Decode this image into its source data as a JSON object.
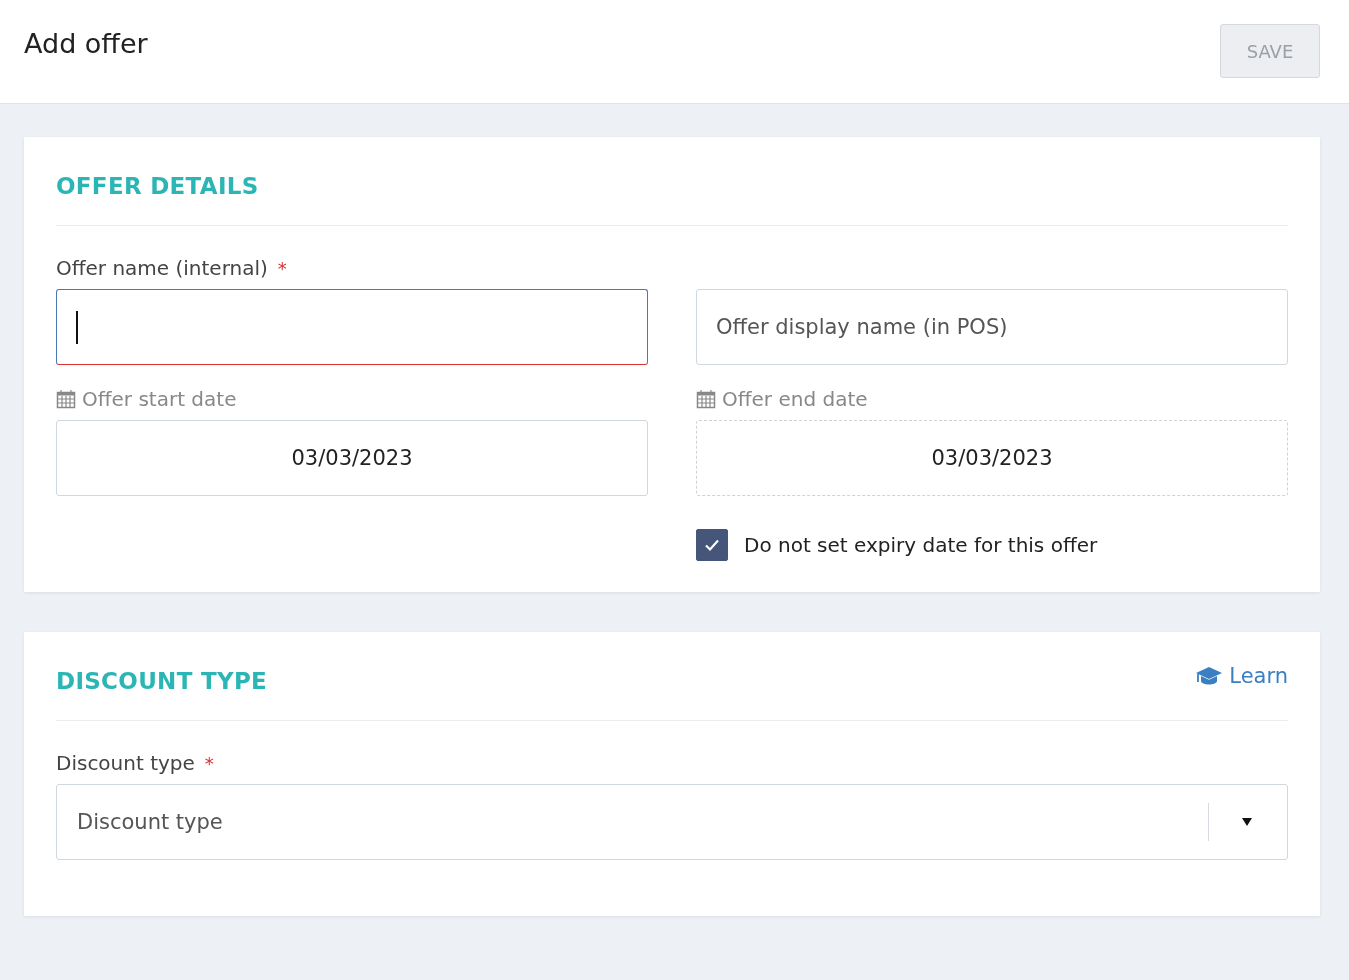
{
  "header": {
    "title": "Add offer",
    "save_button": {
      "label": "SAVE",
      "disabled": true
    }
  },
  "offer_details": {
    "title": "OFFER DETAILS",
    "name_field": {
      "label": "Offer name (internal)",
      "required": true,
      "required_mark": "*",
      "focused": true
    },
    "display_name_field": {
      "placeholder": "Offer display name (in POS)"
    },
    "start_date": {
      "label": "Offer start date",
      "value": "03/03/2023",
      "disabled": false
    },
    "end_date": {
      "label": "Offer end date",
      "value": "03/03/2023",
      "disabled": true
    },
    "no_expiry": {
      "label": "Do not set expiry date for this offer",
      "checked": true
    }
  },
  "discount_type": {
    "title": "DISCOUNT TYPE",
    "learn_link": "Learn",
    "field": {
      "label": "Discount type",
      "required": true,
      "required_mark": "*",
      "placeholder": "Discount type"
    }
  }
}
